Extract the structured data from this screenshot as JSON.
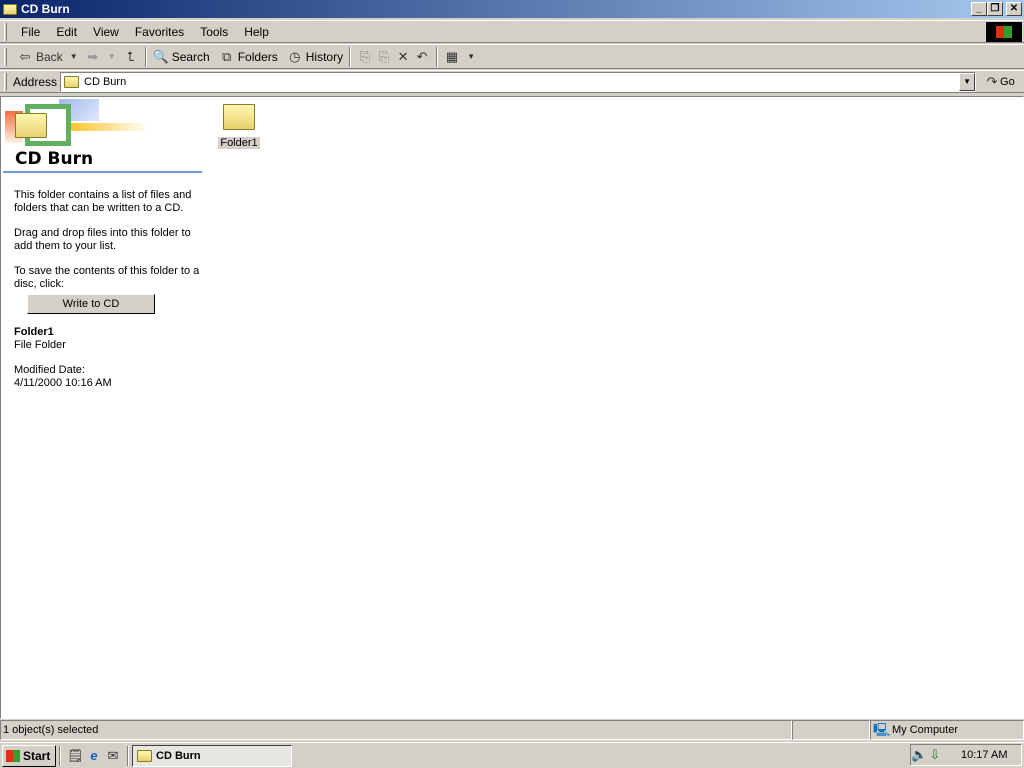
{
  "window": {
    "title": "CD Burn"
  },
  "menu": [
    "File",
    "Edit",
    "View",
    "Favorites",
    "Tools",
    "Help"
  ],
  "toolbar": {
    "back": "Back",
    "search": "Search",
    "folders": "Folders",
    "history": "History"
  },
  "address": {
    "label": "Address",
    "value": "CD Burn",
    "go": "Go"
  },
  "panel": {
    "title": "CD Burn",
    "desc1": "This folder contains a list of files and folders that can be written to a CD.",
    "desc2": "Drag and drop files into this folder to add them to your list.",
    "desc3": "To save the contents of this folder to a disc, click:",
    "write_button": "Write to CD",
    "item_name": "Folder1",
    "item_type": "File Folder",
    "modified_label": "Modified Date:",
    "modified_value": "4/11/2000 10:16 AM"
  },
  "files": [
    {
      "name": "Folder1"
    }
  ],
  "status": {
    "selected": "1 object(s) selected",
    "zone": "My Computer"
  },
  "taskbar": {
    "start": "Start",
    "task": "CD Burn",
    "clock": "10:17 AM"
  }
}
